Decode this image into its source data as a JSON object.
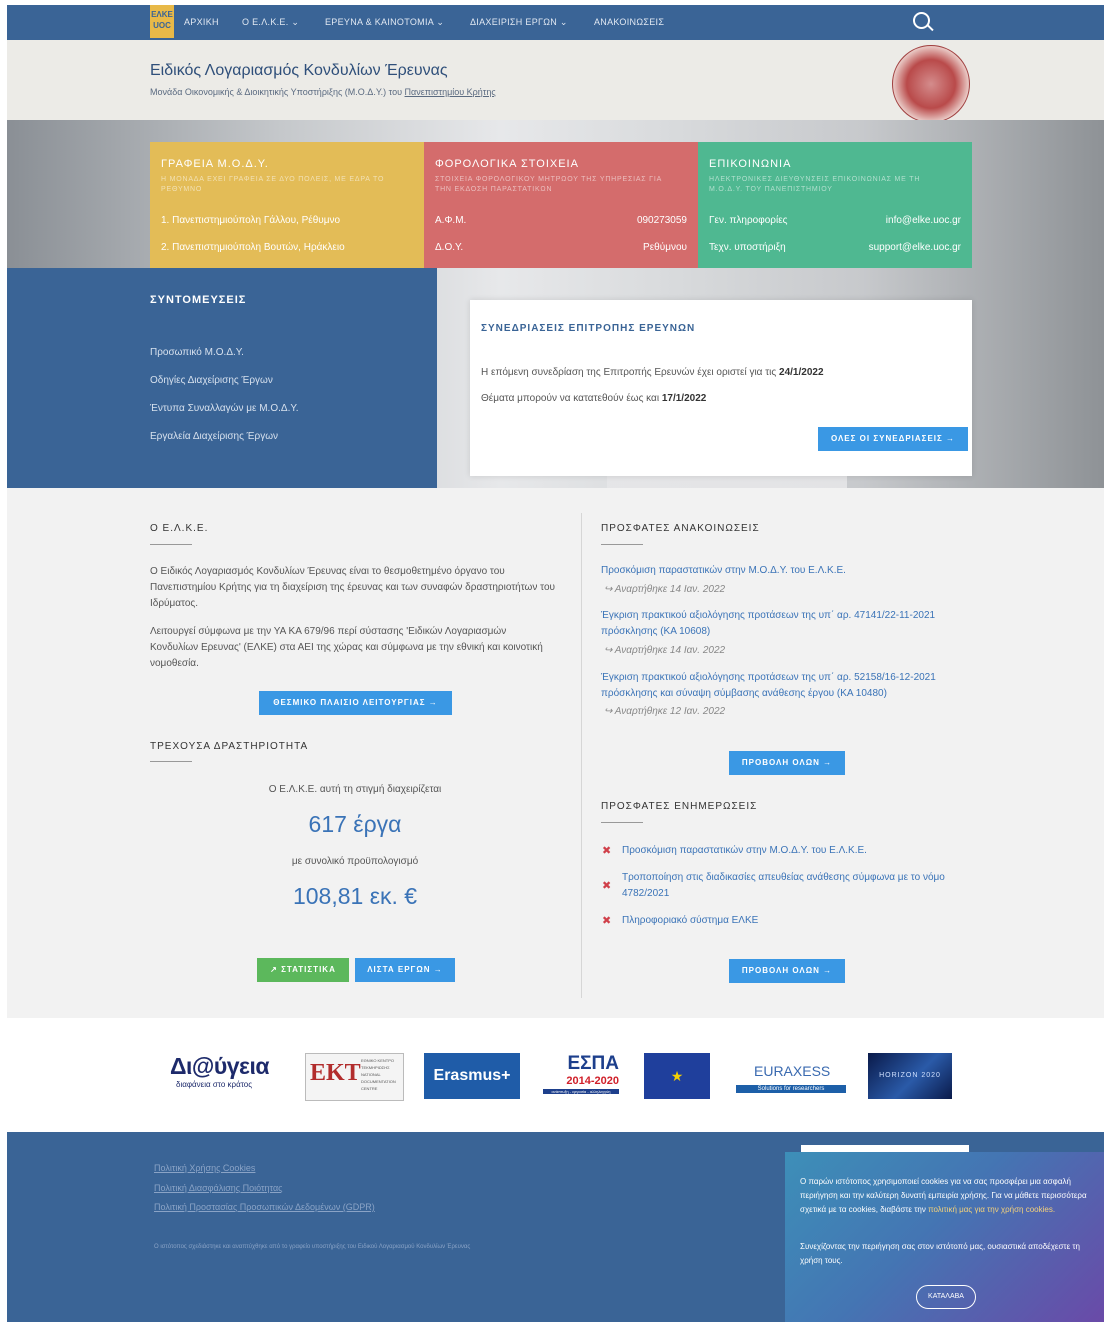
{
  "nav": {
    "logo_top": "ΕΛΚΕ",
    "logo_bottom": "UOC",
    "items": [
      "ΑΡΧΙΚΗ",
      "Ο Ε.Λ.Κ.Ε. ⌄",
      "ΕΡΕΥΝΑ & ΚΑΙΝΟΤΟΜΙΑ ⌄",
      "ΔΙΑΧΕΙΡΙΣΗ ΕΡΓΩΝ ⌄",
      "ΑΝΑΚΟΙΝΩΣΕΙΣ"
    ]
  },
  "header": {
    "title": "Ειδικός Λογαριασμός Κονδυλίων Έρευνας",
    "subtitle_prefix": "Μονάδα Οικονομικής & Διοικητικής Υποστήριξης (Μ.Ο.Δ.Υ.) του ",
    "subtitle_link": "Πανεπιστημίου Κρήτης"
  },
  "boxes": {
    "offices": {
      "title": "ΓΡΑΦΕΙΑ Μ.Ο.Δ.Υ.",
      "subtitle": "Η ΜΟΝΑΔΑ ΕΧΕΙ ΓΡΑΦΕΙΑ ΣΕ ΔΥΟ ΠΟΛΕΙΣ, ΜΕ ΕΔΡΑ ΤΟ ΡΕΘΥΜΝΟ",
      "rows": [
        "1. Πανεπιστημιούπολη Γάλλου, Ρέθυμνο",
        "2. Πανεπιστημιούπολη Βουτών, Ηράκλειο"
      ]
    },
    "tax": {
      "title": "ΦΟΡΟΛΟΓΙΚΑ ΣΤΟΙΧΕΙΑ",
      "subtitle": "ΣΤΟΙΧΕΙΑ ΦΟΡΟΛΟΓΙΚΟΥ ΜΗΤΡΩΟΥ ΤΗΣ ΥΠΗΡΕΣΙΑΣ ΓΙΑ ΤΗΝ ΕΚΔΟΣΗ ΠΑΡΑΣΤΑΤΙΚΩΝ",
      "rows": [
        {
          "k": "Α.Φ.Μ.",
          "v": "090273059"
        },
        {
          "k": "Δ.Ο.Υ.",
          "v": "Ρεθύμνου"
        }
      ]
    },
    "contact": {
      "title": "ΕΠΙΚΟΙΝΩΝΙΑ",
      "subtitle": "ΗΛΕΚΤΡΟΝΙΚΕΣ ΔΙΕΥΘΥΝΣΕΙΣ ΕΠΙΚΟΙΝΩΝΙΑΣ ΜΕ ΤΗ Μ.Ο.Δ.Υ. ΤΟΥ ΠΑΝΕΠΙΣΤΗΜΙΟΥ",
      "rows": [
        {
          "k": "Γεν. πληροφορίες",
          "v": "info@elke.uoc.gr"
        },
        {
          "k": "Τεχν. υποστήριξη",
          "v": "support@elke.uoc.gr"
        }
      ]
    }
  },
  "shortcuts": {
    "title": "ΣΥΝΤΟΜΕΥΣΕΙΣ",
    "links": [
      "Προσωπικό Μ.Ο.Δ.Υ.",
      "Οδηγίες Διαχείρισης Έργων",
      "Έντυπα Συναλλαγών με Μ.Ο.Δ.Υ.",
      "Εργαλεία Διαχείρισης Έργων"
    ]
  },
  "meetings": {
    "title": "ΣΥΝΕΔΡΙΑΣΕΙΣ ΕΠΙΤΡΟΠΗΣ ΕΡΕΥΝΩΝ",
    "line1_prefix": "Η επόμενη συνεδρίαση της Επιτροπής Ερευνών έχει οριστεί για τις ",
    "line1_date": "24/1/2022",
    "line2_prefix": "Θέματα μπορούν να κατατεθούν έως και ",
    "line2_date": "17/1/2022",
    "button": "ΟΛΕΣ ΟΙ ΣΥΝΕΔΡΙΑΣΕΙΣ →"
  },
  "about": {
    "title": "Ο Ε.Λ.Κ.Ε.",
    "p1": "Ο Ειδικός Λογαριασμός Κονδυλίων Έρευνας είναι το θεσμοθετημένο όργανο του Πανεπιστημίου Κρήτης για τη διαχείριση της έρευνας και των συναφών δραστηριοτήτων του Ιδρύματος.",
    "p2": "Λειτουργεί σύμφωνα με την ΥΑ ΚΑ 679/96 περί σύστασης 'Ειδικών Λογαριασμών Κονδυλίων Ερευνας' (ΕΛΚΕ) στα ΑΕΙ της χώρας και σύμφωνα με την εθνική και κοινοτική νομοθεσία.",
    "button": "ΘΕΣΜΙΚΟ ΠΛΑΙΣΙΟ ΛΕΙΤΟΥΡΓΙΑΣ →"
  },
  "activity": {
    "title": "ΤΡΕΧΟΥΣΑ ΔΡΑΣΤΗΡΙΟΤΗΤΑ",
    "intro": "Ο Ε.Λ.Κ.Ε. αυτή τη στιγμή διαχειρίζεται",
    "projects": "617 έργα",
    "budget_label": "με συνολικό προϋπολογισμό",
    "budget": "108,81 εκ. €",
    "btn_stats": "↗ ΣΤΑΤΙΣΤΙΚΑ",
    "btn_list": "ΛΙΣΤΑ ΕΡΓΩΝ →"
  },
  "announcements": {
    "title": "ΠΡΟΣΦΑΤΕΣ ΑΝΑΚΟΙΝΩΣΕΙΣ",
    "items": [
      {
        "text": "Προσκόμιση παραστατικών στην Μ.Ο.Δ.Υ. του Ε.Λ.Κ.Ε.",
        "meta": "↪ Αναρτήθηκε 14 Ιαν. 2022"
      },
      {
        "text": "Έγκριση πρακτικού αξιολόγησης προτάσεων της υπ΄ αρ. 47141/22-11-2021 πρόσκλησης (ΚΑ 10608)",
        "meta": "↪ Αναρτήθηκε 14 Ιαν. 2022"
      },
      {
        "text": "Έγκριση πρακτικού αξιολόγησης προτάσεων της υπ΄ αρ. 52158/16-12-2021 πρόσκλησης και σύναψη σύμβασης ανάθεσης έργου (ΚΑ 10480)",
        "meta": "↪ Αναρτήθηκε 12 Ιαν. 2022"
      }
    ],
    "button": "ΠΡΟΒΟΛΗ ΟΛΩΝ →"
  },
  "updates": {
    "title": "ΠΡΟΣΦΑΤΕΣ ΕΝΗΜΕΡΩΣΕΙΣ",
    "items": [
      "Προσκόμιση παραστατικών στην Μ.Ο.Δ.Υ. του Ε.Λ.Κ.Ε.",
      "Τροποποίηση στις διαδικασίες απευθείας ανάθεσης σύμφωνα με το νόμο 4782/2021",
      "Πληροφοριακό σύστημα ΕΛΚΕ"
    ],
    "button": "ΠΡΟΒΟΛΗ ΟΛΩΝ →"
  },
  "logos": {
    "diavgeia": "Δι@ύγεια",
    "diavgeia_sub": "διαφάνεια στο κράτος",
    "ekt": "ΕΚΤ",
    "ekt_side": "ΕΘΝΙΚΟ ΚΕΝΤΡΟ ΤΕΚΜΗΡΙΩΣΗΣ NATIONAL DOCUMENTATION CENTRE",
    "erasmus": "Erasmus+",
    "espa": "ΕΣΠΑ",
    "espa_years": "2014-2020",
    "espa_sub": "ανάπτυξη - εργασία - αλληλεγγύη",
    "euraxess": "EURAXESS",
    "euraxess_sub": "Solutions for researchers",
    "horizon": "HORIZON 2020"
  },
  "footer": {
    "links": [
      "Πολιτική Χρήσης Cookies",
      "Πολιτική Διασφάλισης Ποιότητας",
      "Πολιτική Προστασίας Προσωπικών Δεδομένων (GDPR)"
    ],
    "credit": "Ο ιστότοπος σχεδιάστηκε και αναπτύχθηκε από το γραφείο υποστήριξης του Ειδικού Λογαριασμού Κονδυλίων Έρευνας"
  },
  "cookie": {
    "p1": "Ο παρών ιστότοπος χρησιμοποιεί cookies για να σας προσφέρει μια ασφαλή περιήγηση και την καλύτερη δυνατή εμπειρία χρήσης. Για να μάθετε περισσότερα σχετικά με τα cookies, διαβάστε την ",
    "p1_link": "πολιτική μας για την χρήση cookies.",
    "p2": "Συνεχίζοντας την περιήγηση σας στον ιστότοπό μας, ουσιαστικά αποδέχεστε τη χρήση τους.",
    "ok": "ΚΑΤΑΛΑΒΑ"
  },
  "colors": {
    "nav": "#3a6496",
    "yellow": "#e3bc57",
    "red": "#d46c6c",
    "green": "#4fb891",
    "button": "#3a98e4"
  }
}
